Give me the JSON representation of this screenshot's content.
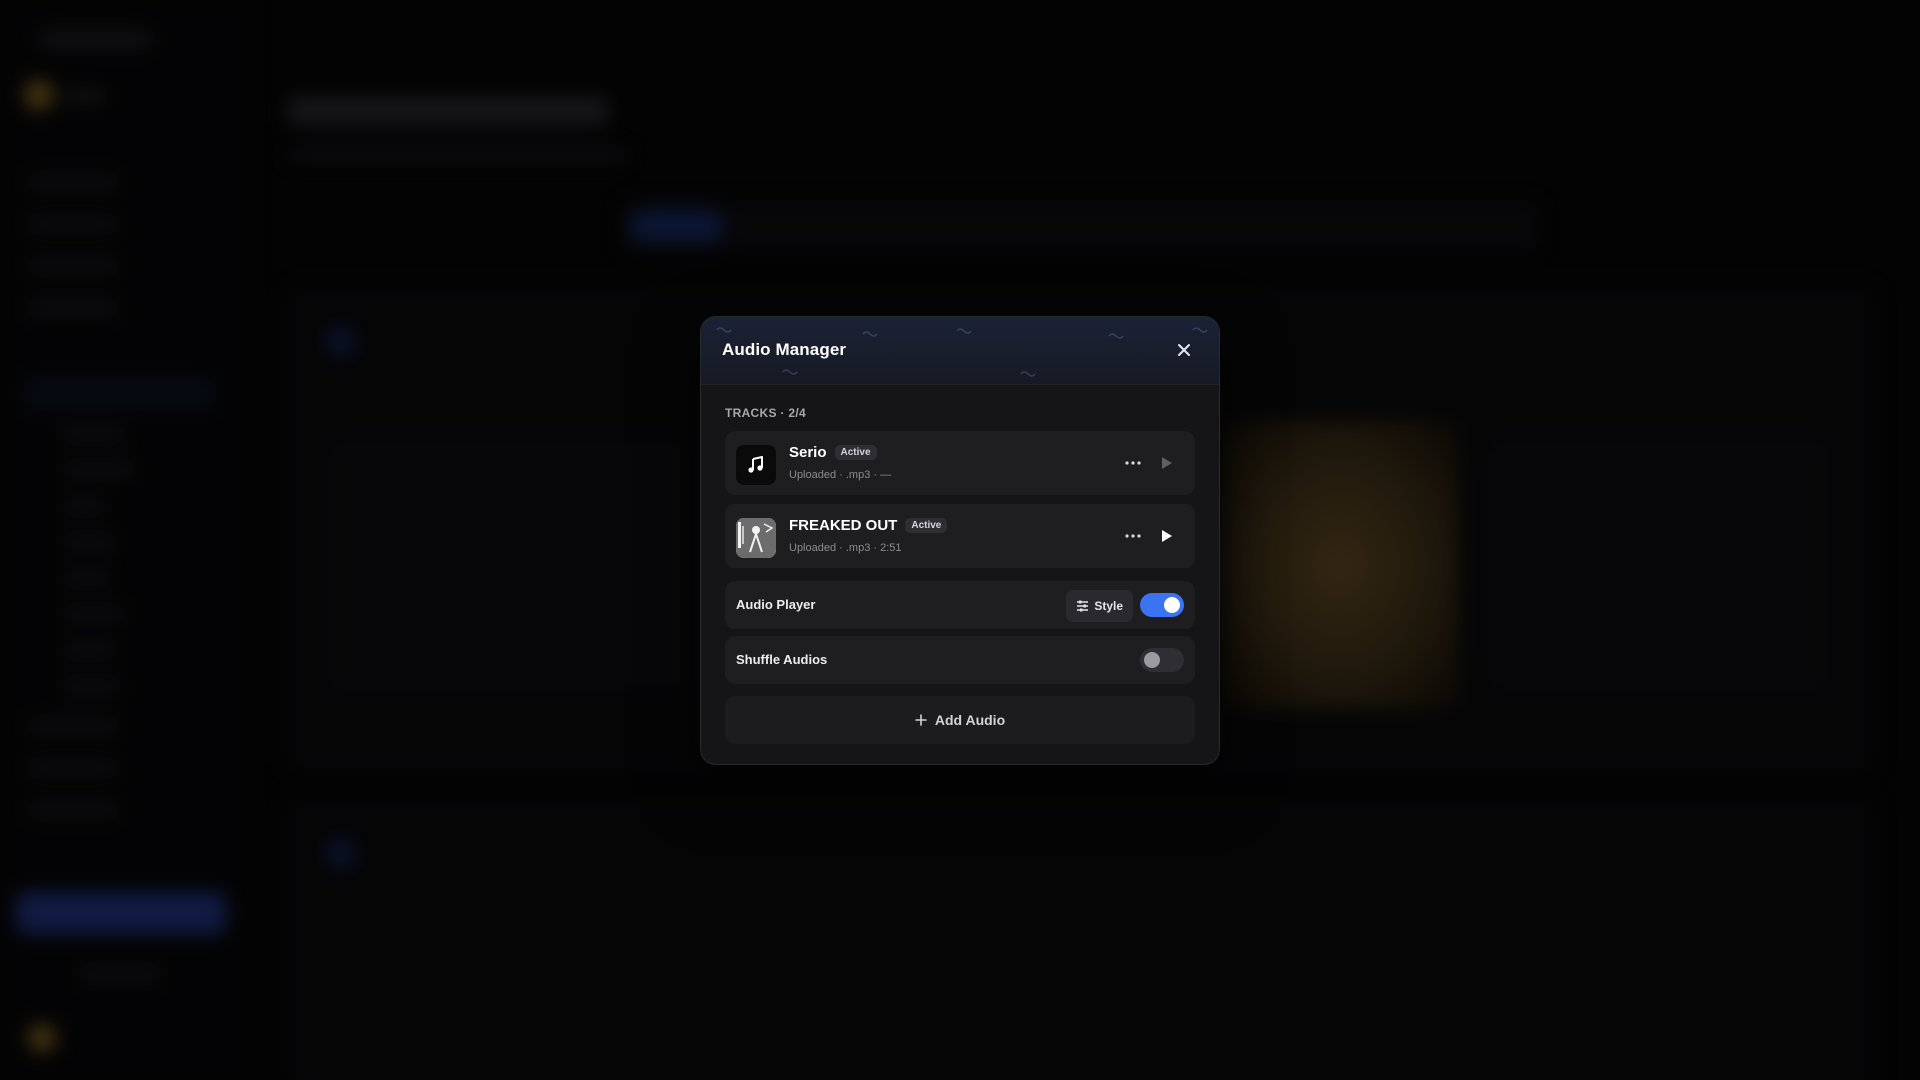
{
  "modal": {
    "title": "Audio Manager",
    "close_icon": "close-icon"
  },
  "tracks": {
    "label": "TRACKS · 2/4",
    "items": [
      {
        "name": "Serio",
        "badge": "Active",
        "meta": "Uploaded · .mp3 · —",
        "thumb_icon": "music-note-icon"
      },
      {
        "name": "FREAKED OUT",
        "badge": "Active",
        "meta": "Uploaded · .mp3 · 2:51",
        "thumb_icon": "album-art"
      }
    ]
  },
  "audio_player": {
    "label": "Audio Player",
    "style_label": "Style",
    "enabled": true
  },
  "shuffle": {
    "label": "Shuffle Audios",
    "enabled": false
  },
  "add_audio": {
    "label": "Add Audio"
  },
  "colors": {
    "accent": "#3b74f2",
    "modal_bg": "#151517",
    "row_bg": "#1e1e21"
  }
}
